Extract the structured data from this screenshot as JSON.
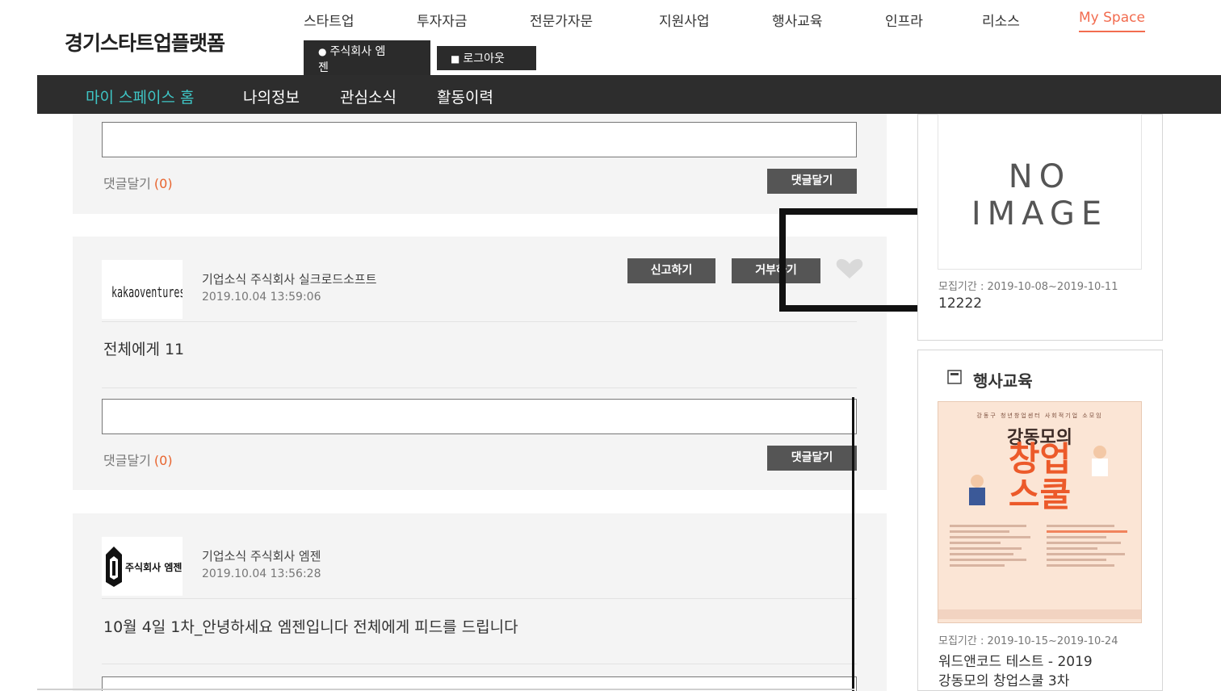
{
  "header": {
    "logo": "경기스타트업플랫폼",
    "gnb": [
      {
        "label": "스타트업"
      },
      {
        "label": "투자자금"
      },
      {
        "label": "전문가자문"
      },
      {
        "label": "지원사업"
      },
      {
        "label": "행사교육"
      },
      {
        "label": "인프라"
      },
      {
        "label": "리소스"
      },
      {
        "label": "My Space"
      }
    ],
    "user_label_line1": "주식회사 엠",
    "user_label_line2": "젠",
    "logout_label": "로그아웃"
  },
  "subnav": [
    {
      "label": "마이 스페이스 홈"
    },
    {
      "label": "나의정보"
    },
    {
      "label": "관심소식"
    },
    {
      "label": "활동이력"
    }
  ],
  "feed": {
    "comment_link": "댓글달기",
    "comment_button": "댓글달기",
    "report_button": "신고하기",
    "reject_button": "거부하기",
    "posts": [
      {
        "comment_count": "(0)"
      },
      {
        "avatar_text": "kakaoventures",
        "meta": "기업소식 주식회사 실크로드소프트",
        "date": "2019.10.04 13:59:06",
        "body": "전체에게 11",
        "comment_count": "(0)"
      },
      {
        "avatar_text": "주식회사 엠젠",
        "meta": "기업소식 주식회사 엠젠",
        "date": "2019.10.04 13:56:28",
        "body": "10월 4일 1차_안녕하세요 엠젠입니다 전체에게 피드를 드립니다"
      }
    ]
  },
  "sidebar": {
    "recruit_card": {
      "image_line1": "NO",
      "image_line2": "IMAGE",
      "date": "모집기간 : 2019-10-08~2019-10-11",
      "title": "12222"
    },
    "event_section": {
      "title": "행사교육",
      "poster": {
        "top": "강동구 청년창업센터 사회적기업 소모임",
        "line1": "강동모의",
        "line2": "창업",
        "line3": "스쿨"
      },
      "date": "모집기간 : 2019-10-15~2019-10-24",
      "title_line1": "워드앤코드 테스트 - 2019",
      "title_line2": "강동모의 창업스쿨 3차"
    }
  },
  "colors": {
    "accent": "#f26c4f",
    "subnav_active": "#3ec5c5",
    "comment_count": "#e8642e",
    "dark_bar": "#2d2d2d"
  }
}
